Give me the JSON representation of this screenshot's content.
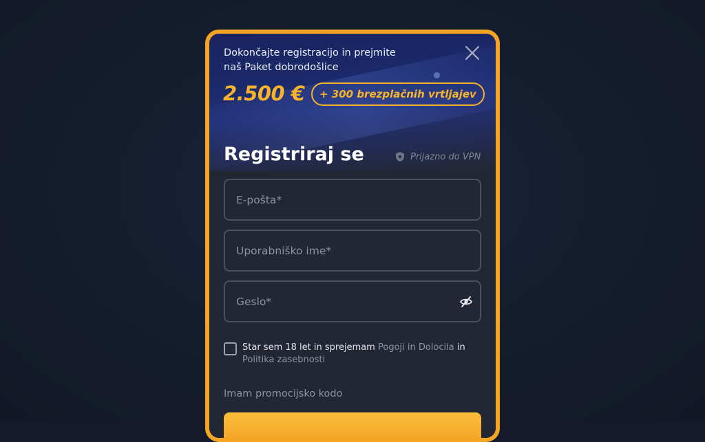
{
  "promo": {
    "line1": "Dokončajte registracijo in prejmite",
    "line2": "naš Paket dobrodošlice",
    "amount": "2.500 €",
    "spins": "+ 300 brezplačnih vrtljajev"
  },
  "form": {
    "title": "Registriraj se",
    "vpn_label": "Prijazno do VPN",
    "email_placeholder": "E-pošta*",
    "username_placeholder": "Uporabniško ime*",
    "password_placeholder": "Geslo*",
    "consent_prefix": "Star sem 18 let in sprejemam",
    "terms_link": "Pogoji in Dolocila",
    "consent_and": "in",
    "privacy_link": "Politika zasebnosti",
    "promo_code_label": "Imam promocijsko kodo"
  },
  "colors": {
    "accent": "#f5a524",
    "modal_bg": "#232733",
    "page_bg": "#141a29"
  },
  "icons": {
    "close": "close-icon",
    "vpn": "shield-icon",
    "password_toggle": "eye-off-icon"
  }
}
